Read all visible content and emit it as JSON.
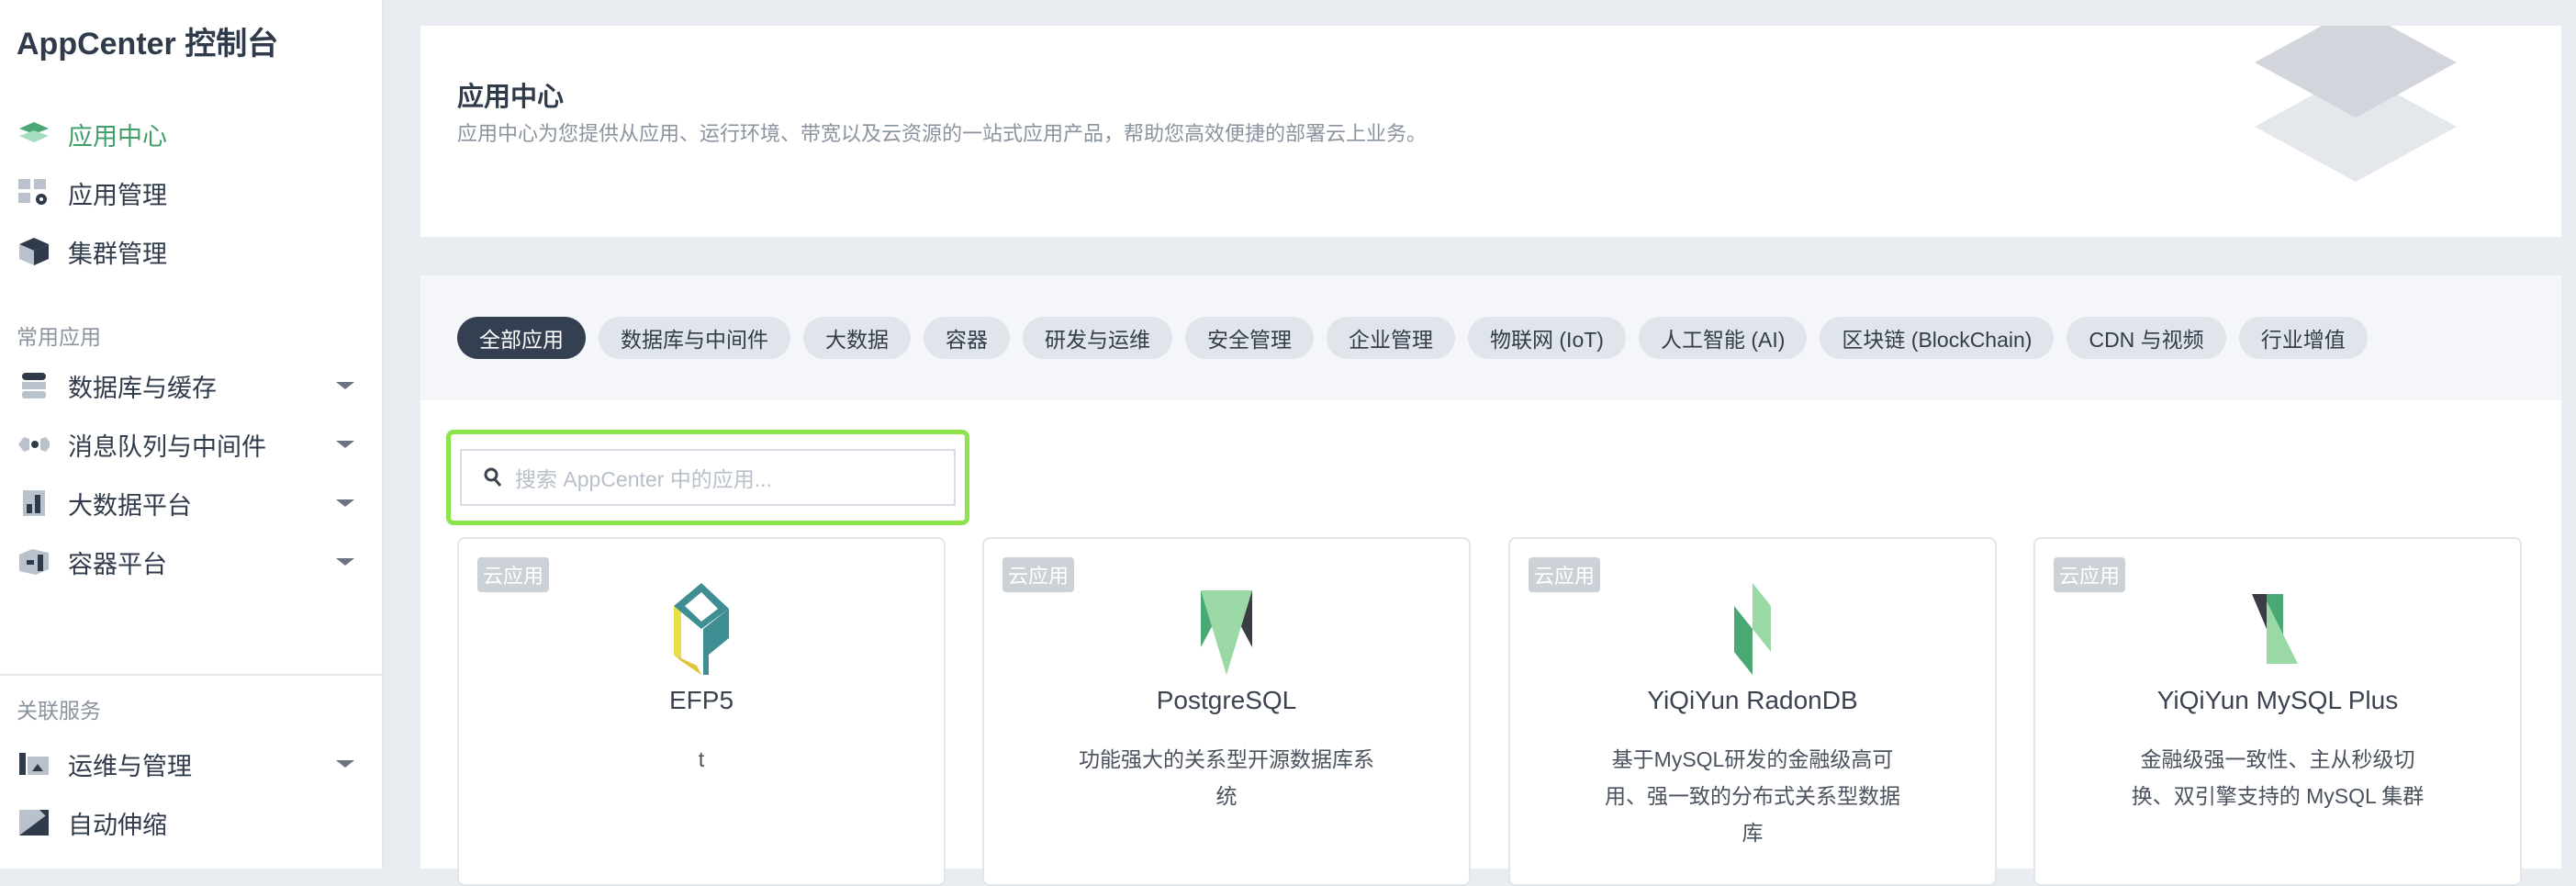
{
  "sidebar": {
    "title": "AppCenter 控制台",
    "main_items": [
      {
        "label": "应用中心",
        "icon": "layers-icon",
        "active": true
      },
      {
        "label": "应用管理",
        "icon": "app-manage-icon"
      },
      {
        "label": "集群管理",
        "icon": "cube-icon"
      }
    ],
    "common_label": "常用应用",
    "common_items": [
      {
        "label": "数据库与缓存",
        "icon": "database-icon"
      },
      {
        "label": "消息队列与中间件",
        "icon": "message-queue-icon"
      },
      {
        "label": "大数据平台",
        "icon": "bar-chart-icon"
      },
      {
        "label": "容器平台",
        "icon": "container-icon"
      }
    ],
    "related_label": "关联服务",
    "related_items": [
      {
        "label": "运维与管理",
        "icon": "ops-icon",
        "expandable": true
      },
      {
        "label": "自动伸缩",
        "icon": "autoscale-icon"
      }
    ]
  },
  "header": {
    "title": "应用中心",
    "subtitle": "应用中心为您提供从应用、运行环境、带宽以及云资源的一站式应用产品，帮助您高效便捷的部署云上业务。"
  },
  "filters": [
    "全部应用",
    "数据库与中间件",
    "大数据",
    "容器",
    "研发与运维",
    "安全管理",
    "企业管理",
    "物联网 (IoT)",
    "人工智能 (AI)",
    "区块链 (BlockChain)",
    "CDN 与视频",
    "行业增值"
  ],
  "search": {
    "placeholder": "搜索 AppCenter 中的应用..."
  },
  "cards": [
    {
      "tag": "云应用",
      "title": "EFP5",
      "desc": "t"
    },
    {
      "tag": "云应用",
      "title": "PostgreSQL",
      "desc": "功能强大的关系型开源数据库系统"
    },
    {
      "tag": "云应用",
      "title": "YiQiYun RadonDB",
      "desc": "基于MySQL研发的金融级高可用、强一致的分布式关系型数据库"
    },
    {
      "tag": "云应用",
      "title": "YiQiYun MySQL Plus",
      "desc": "金融级强一致性、主从秒级切换、双引擎支持的 MySQL 集群"
    }
  ],
  "colors": {
    "accent": "#3e9f68",
    "highlight": "#8ee54b",
    "chip_selected": "#343f51"
  }
}
